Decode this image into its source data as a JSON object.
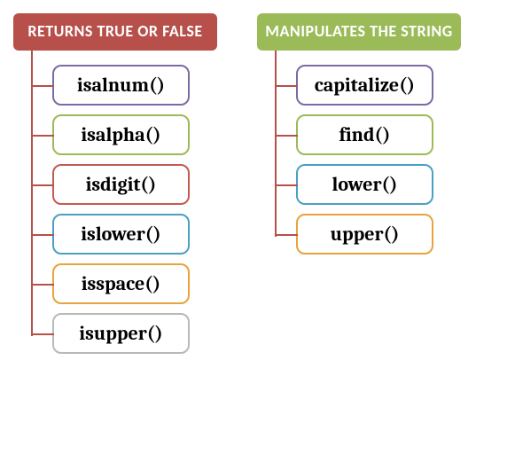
{
  "columns": [
    {
      "header": "RETURNS TRUE OR FALSE",
      "header_color": "#b74f4a",
      "spine_color": "#b74f4a",
      "items": [
        {
          "label": "isalnum()",
          "border": "purple"
        },
        {
          "label": "isalpha()",
          "border": "green"
        },
        {
          "label": "isdigit()",
          "border": "red"
        },
        {
          "label": "islower()",
          "border": "blue"
        },
        {
          "label": "isspace()",
          "border": "orange"
        },
        {
          "label": "isupper()",
          "border": "gray"
        }
      ]
    },
    {
      "header": "MANIPULATES THE STRING",
      "header_color": "#9bbb59",
      "spine_color": "#b74f4a",
      "items": [
        {
          "label": "capitalize()",
          "border": "purple"
        },
        {
          "label": "find()",
          "border": "green"
        },
        {
          "label": "lower()",
          "border": "blue"
        },
        {
          "label": "upper()",
          "border": "orange"
        }
      ]
    }
  ]
}
